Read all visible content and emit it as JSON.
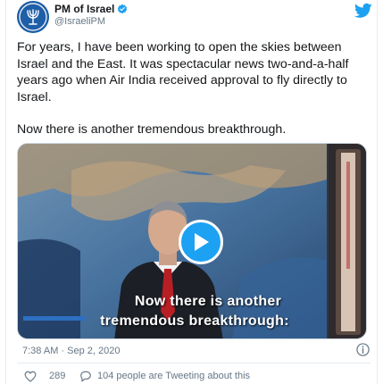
{
  "tweet": {
    "display_name": "PM of Israel",
    "handle": "@IsraeliPM",
    "paragraphs": [
      "For years, I have been working to open the skies between Israel and the East. It was spectacular news two-and-a-half years ago when Air India received approval to fly directly to Israel.",
      "Now there is another tremendous breakthrough."
    ],
    "timestamp": "7:38 AM · Sep 2, 2020",
    "like_count": "289",
    "activity_text": "104 people are Tweeting about this"
  },
  "media": {
    "caption_line1": "Now there is another",
    "caption_line2": "tremendous breakthrough:"
  },
  "colors": {
    "accent": "#1da1f2",
    "text": "#14171a",
    "secondary_text": "#657786",
    "border": "#e6ecf0"
  },
  "icons": [
    "avatar-emblem",
    "verified-badge-icon",
    "twitter-bird-icon",
    "play-icon",
    "info-icon",
    "heart-icon",
    "reply-bubble-icon"
  ]
}
